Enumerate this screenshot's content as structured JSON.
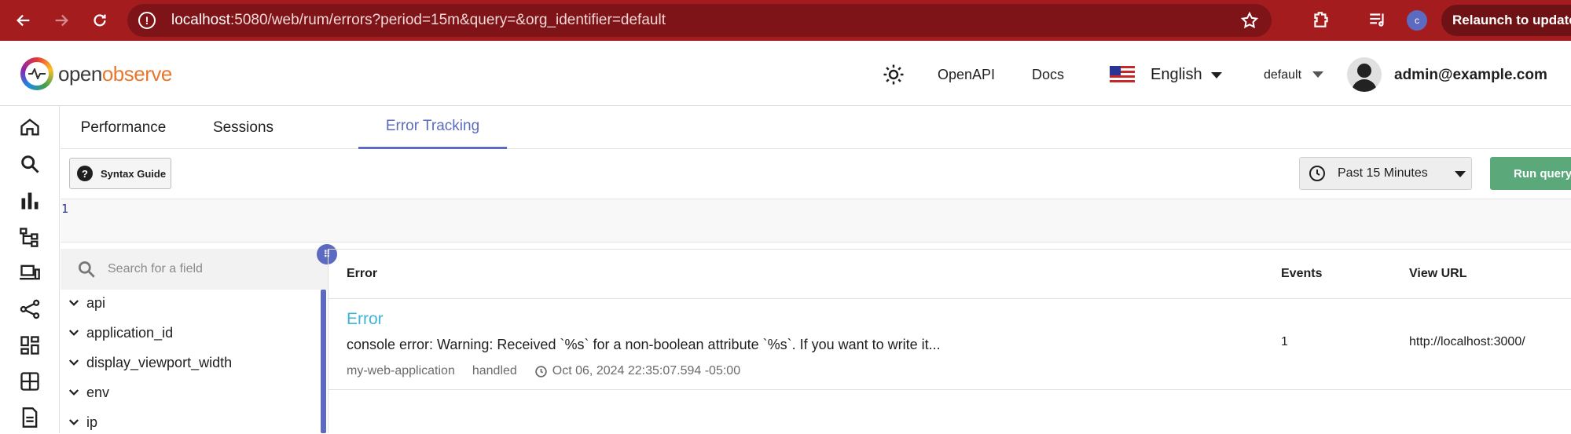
{
  "browser": {
    "url_host": "localhost",
    "url_rest": ":5080/web/rum/errors?period=15m&query=&org_identifier=default",
    "profile_initial": "c",
    "relaunch_label": "Relaunch to update"
  },
  "header": {
    "logo_open": "open",
    "logo_observe": "observe",
    "openapi_label": "OpenAPI",
    "docs_label": "Docs",
    "language": "English",
    "org": "default",
    "user_email": "admin@example.com"
  },
  "tabs": [
    {
      "label": "Performance"
    },
    {
      "label": "Sessions"
    },
    {
      "label": "Error Tracking"
    }
  ],
  "toolbar": {
    "syntax_guide_label": "Syntax Guide",
    "time_range": "Past 15 Minutes",
    "run_query_label": "Run query"
  },
  "editor": {
    "line_number": "1"
  },
  "fields": {
    "search_placeholder": "Search for a field",
    "items": [
      {
        "label": "api"
      },
      {
        "label": "application_id"
      },
      {
        "label": "display_viewport_width"
      },
      {
        "label": "env"
      },
      {
        "label": "ip"
      }
    ]
  },
  "table": {
    "columns": [
      "Error",
      "Events",
      "View URL"
    ],
    "rows": [
      {
        "title": "Error",
        "message": "console error: Warning: Received `%s` for a non-boolean attribute `%s`. If you want to write it...",
        "service": "my-web-application",
        "handling": "handled",
        "timestamp": "Oct 06, 2024 22:35:07.594 -05:00",
        "events": "1",
        "view_url": "http://localhost:3000/"
      }
    ]
  },
  "colors": {
    "browser_chrome": "#a51c1f",
    "accent": "#5c6bc0",
    "run_button": "#5ba87a",
    "error_title": "#3fb6d6"
  }
}
